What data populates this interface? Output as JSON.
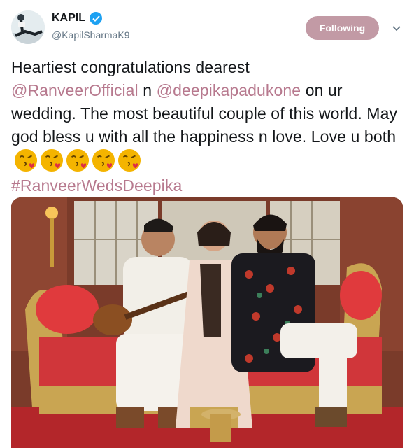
{
  "account": {
    "display_name": "KAPIL",
    "handle": "@KapilSharmaK9",
    "verified": true
  },
  "follow_button": {
    "label": "Following"
  },
  "tweet": {
    "text_line1": "Heartiest congratulations dearest",
    "mention1": "@RanveerOfficial",
    "connector1": " n ",
    "mention2": "@deepikapadukone",
    "text_rest": " on ur wedding. The most beautiful couple of this world. May god bless u with all the happiness n love. Love u both",
    "hashtag": "#RanveerWedsDeepika",
    "emojis": [
      "kiss-face",
      "kiss-face",
      "kiss-face",
      "kiss-face",
      "kiss-face"
    ]
  },
  "colors": {
    "accent": "#c29aa5",
    "link": "#b7798e",
    "verified": "#1da1f2",
    "text": "#14171a",
    "muted": "#657786"
  },
  "icons": {
    "verified": "verified-badge-icon",
    "caret": "chevron-down-icon",
    "emoji": "face-blowing-kiss-icon"
  }
}
